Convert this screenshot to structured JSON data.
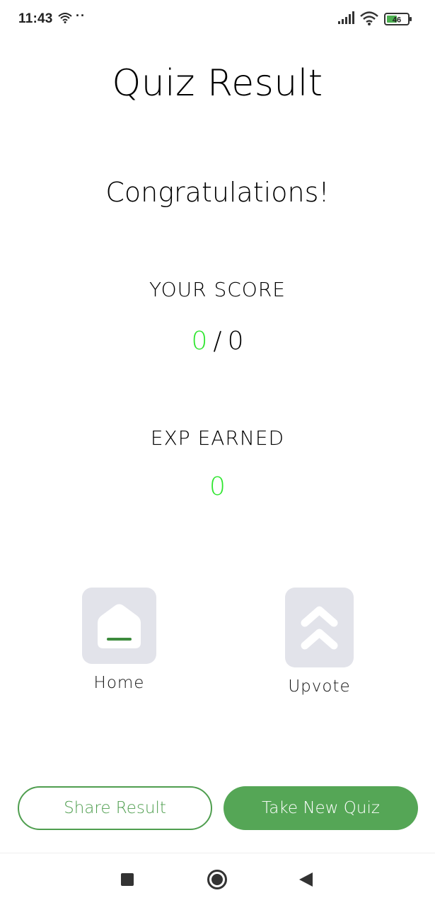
{
  "status_bar": {
    "time": "11:43",
    "dots": "··",
    "battery_level": "46",
    "icons": [
      "wifi-icon",
      "signal-icon",
      "battery-icon"
    ]
  },
  "page": {
    "title": "Quiz Result",
    "congratulations": "Congratulations!"
  },
  "score": {
    "label": "YOUR SCORE",
    "value": "0",
    "separator": "/",
    "total": "0"
  },
  "exp": {
    "label": "EXP EARNED",
    "value": "0"
  },
  "actions": {
    "home_label": "Home",
    "upvote_label": "Upvote"
  },
  "buttons": {
    "share_label": "Share Result",
    "take_new_label": "Take New Quiz"
  },
  "colors": {
    "accent_green": "#55a656",
    "score_green": "#2ee62e",
    "tile_bg": "#e2e3ea"
  }
}
